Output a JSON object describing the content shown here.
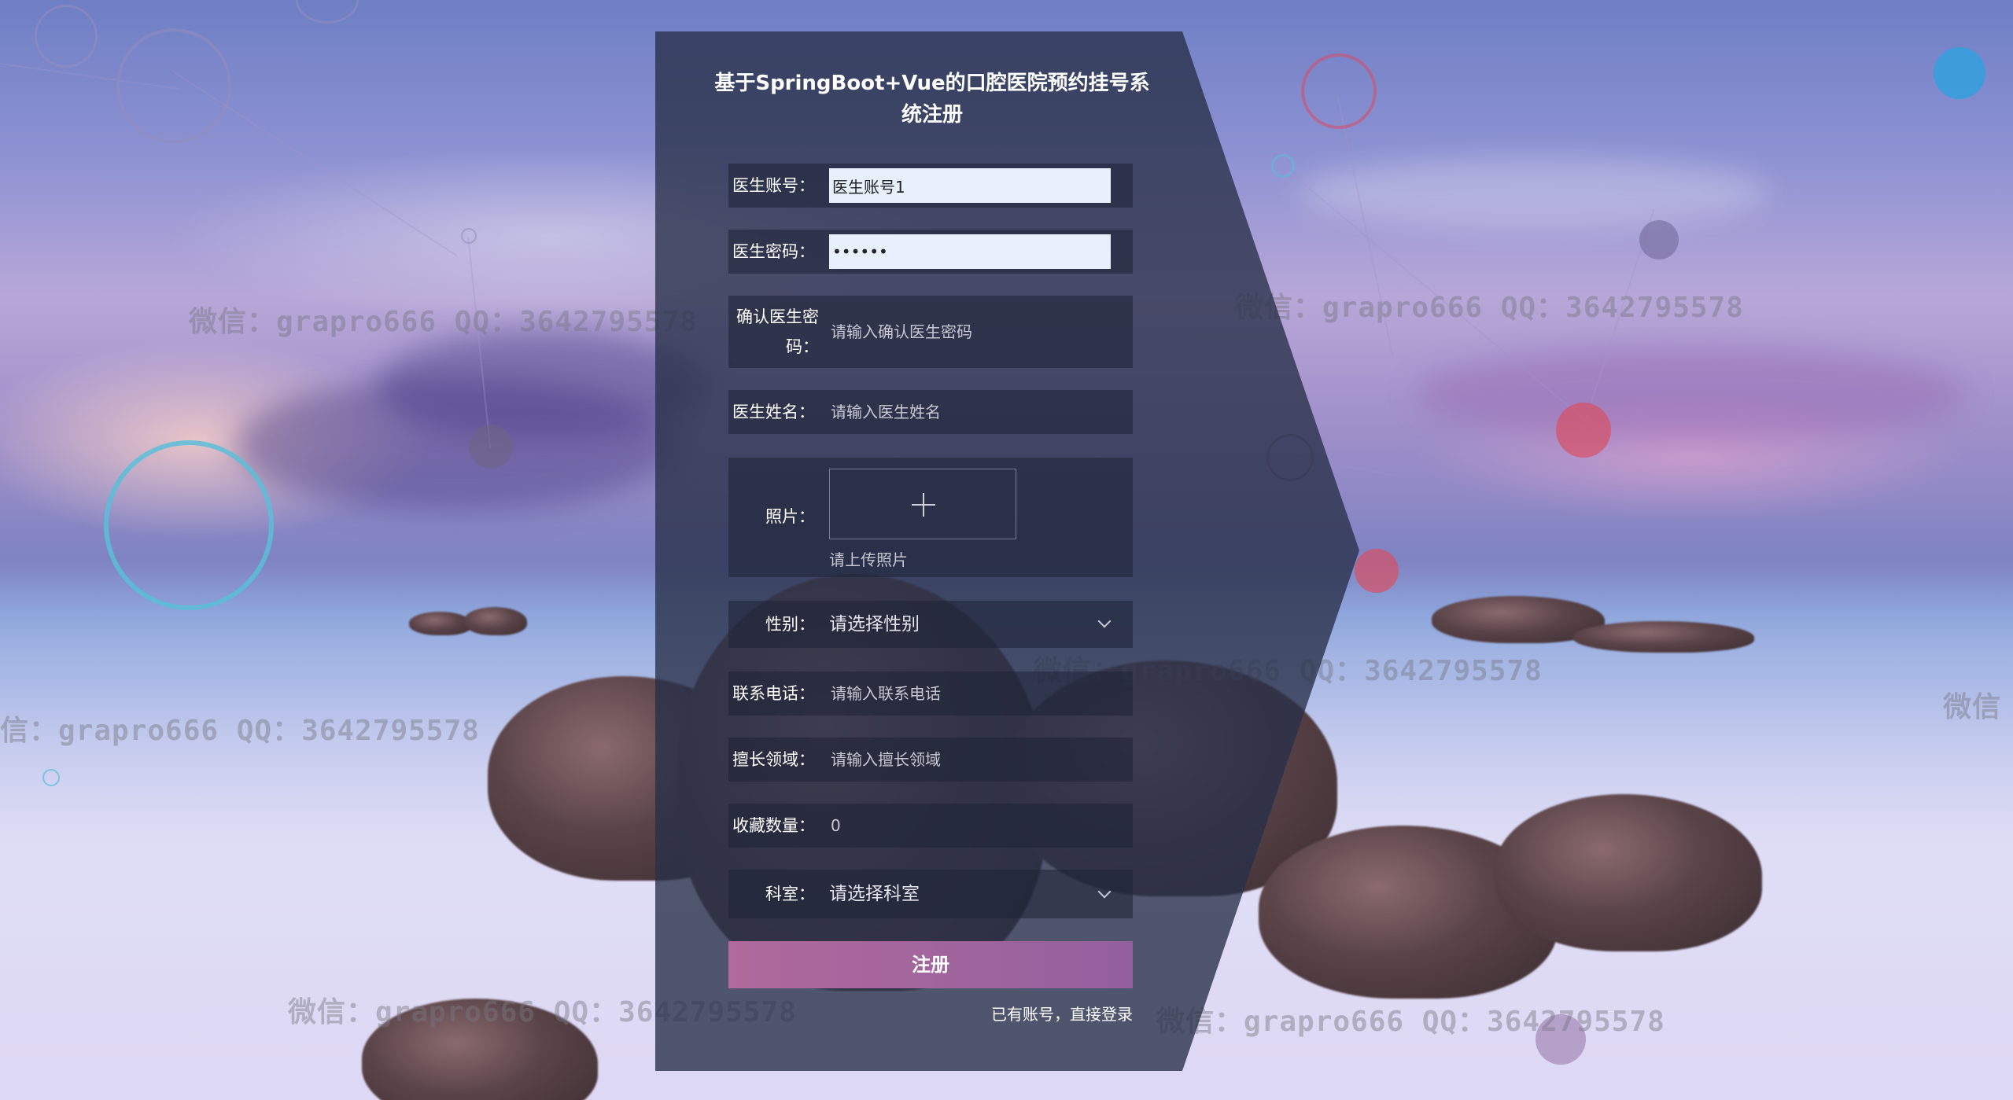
{
  "page": {
    "title": "基于SpringBoot+Vue的口腔医院预约挂号系统注册"
  },
  "form": {
    "account": {
      "label": "医生账号：",
      "value": "医生账号1"
    },
    "password": {
      "label": "医生密码：",
      "value": "••••••"
    },
    "confirm_password": {
      "label": "确认医生密码：",
      "placeholder": "请输入确认医生密码"
    },
    "name": {
      "label": "医生姓名：",
      "placeholder": "请输入医生姓名"
    },
    "photo": {
      "label": "照片：",
      "hint": "请上传照片",
      "icon": "plus-icon"
    },
    "gender": {
      "label": "性别：",
      "placeholder": "请选择性别",
      "icon": "chevron-down-icon"
    },
    "phone": {
      "label": "联系电话：",
      "placeholder": "请输入联系电话"
    },
    "specialty": {
      "label": "擅长领域：",
      "placeholder": "请输入擅长领域"
    },
    "favorites": {
      "label": "收藏数量：",
      "placeholder": "0"
    },
    "department": {
      "label": "科室：",
      "placeholder": "请选择科室",
      "icon": "chevron-down-icon"
    }
  },
  "actions": {
    "register_label": "注册",
    "login_link": "已有账号，直接登录"
  },
  "watermarks": {
    "w1": "微信：grapro666 QQ：3642795578",
    "w2": "微信：grapro666 QQ：3642795578",
    "w3": "信：grapro666 QQ：3642795578",
    "w4": "微信：grapro666 QQ：3642795578",
    "w5": "微信：grapro666 QQ：3642795578",
    "w6": "微信：grapro666 QQ：3642795578",
    "w7": "微信"
  },
  "colors": {
    "panel": "#283048",
    "button_gradient_start": "#b06a9c",
    "button_gradient_end": "#93609e",
    "input_filled_bg": "#e8f0fe"
  }
}
